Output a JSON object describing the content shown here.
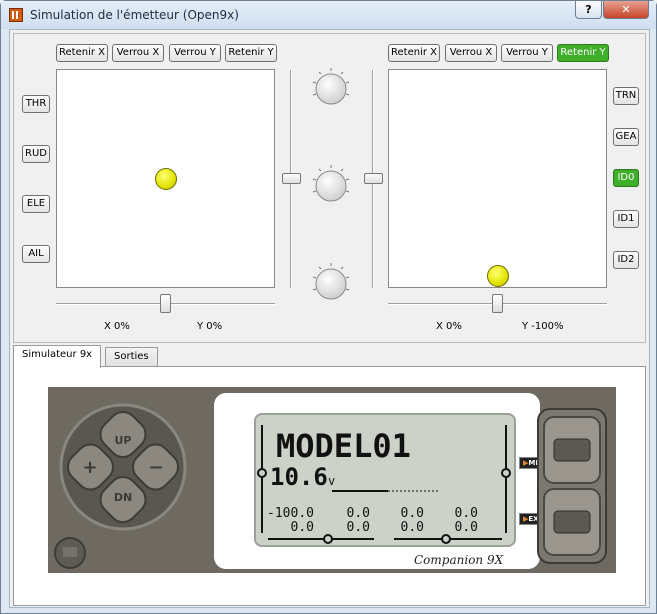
{
  "window": {
    "title": "Simulation de l'émetteur (Open9x)",
    "help_label": "?",
    "close_label": "✕"
  },
  "left_stick": {
    "buttons": [
      "Retenir X",
      "Verrou X",
      "Verrou Y",
      "Retenir Y"
    ],
    "x_label": "X  0%",
    "y_label": "Y  0%",
    "x_value": 0,
    "y_value": 0
  },
  "right_stick": {
    "buttons": [
      "Retenir X",
      "Verrou X",
      "Verrou Y",
      "Retenir Y"
    ],
    "active_button": "Retenir Y",
    "x_label": "X  0%",
    "y_label": "Y -100%",
    "x_value": 0,
    "y_value": -100
  },
  "left_switches": [
    "THR",
    "RUD",
    "ELE",
    "AIL"
  ],
  "right_switches": [
    "TRN",
    "GEA",
    "ID0",
    "ID1",
    "ID2"
  ],
  "right_switches_active": "ID0",
  "knobs": [
    "knob-1",
    "knob-2",
    "knob-3"
  ],
  "tabs": [
    {
      "label": "Simulateur 9x",
      "active": true
    },
    {
      "label": "Sorties",
      "active": false
    }
  ],
  "radio": {
    "keypad": {
      "up": "UP",
      "down": "DN",
      "plus": "+",
      "minus": "−"
    },
    "menu_label": "MENU",
    "exit_label": "EXIT",
    "brand": "Companion 9X",
    "lcd": {
      "model_name": "MODEL01",
      "voltage": "10.6",
      "voltage_unit": "v",
      "values": [
        "-100.0",
        "0.0",
        "0.0",
        "0.0",
        "0.0",
        "0.0",
        "0.0",
        "0.0"
      ]
    }
  },
  "colors": {
    "accent_green": "#3fae2a",
    "stick_dot": "#e3e300",
    "window_frame": "#dde8f3"
  }
}
